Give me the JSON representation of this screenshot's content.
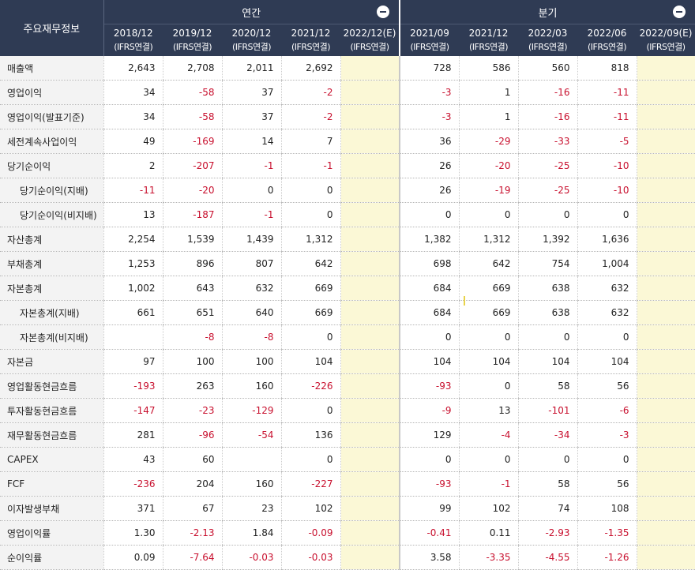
{
  "header": {
    "corner_label": "주요재무정보",
    "annual_label": "연간",
    "quarter_label": "분기",
    "periods": [
      {
        "period": "2018/12",
        "standard": "(IFRS연결)"
      },
      {
        "period": "2019/12",
        "standard": "(IFRS연결)"
      },
      {
        "period": "2020/12",
        "standard": "(IFRS연결)"
      },
      {
        "period": "2021/12",
        "standard": "(IFRS연결)"
      },
      {
        "period": "2022/12(E)",
        "standard": "(IFRS연결)"
      },
      {
        "period": "2021/09",
        "standard": "(IFRS연결)"
      },
      {
        "period": "2021/12",
        "standard": "(IFRS연결)"
      },
      {
        "period": "2022/03",
        "standard": "(IFRS연결)"
      },
      {
        "period": "2022/06",
        "standard": "(IFRS연결)"
      },
      {
        "period": "2022/09(E)",
        "standard": "(IFRS연결)"
      }
    ]
  },
  "colors": {
    "header_bg": "#2f3b54",
    "negative": "#c8102e",
    "estimate_bg": "#fbf8d6",
    "label_bg": "#f3f3f3"
  },
  "rows": [
    {
      "label": "매출액",
      "values": [
        "2,643",
        "2,708",
        "2,011",
        "2,692",
        "",
        "728",
        "586",
        "560",
        "818",
        ""
      ]
    },
    {
      "label": "영업이익",
      "values": [
        "34",
        "-58",
        "37",
        "-2",
        "",
        "-3",
        "1",
        "-16",
        "-11",
        ""
      ]
    },
    {
      "label": "영업이익(발표기준)",
      "values": [
        "34",
        "-58",
        "37",
        "-2",
        "",
        "-3",
        "1",
        "-16",
        "-11",
        ""
      ]
    },
    {
      "label": "세전계속사업이익",
      "values": [
        "49",
        "-169",
        "14",
        "7",
        "",
        "36",
        "-29",
        "-33",
        "-5",
        ""
      ]
    },
    {
      "label": "당기순이익",
      "values": [
        "2",
        "-207",
        "-1",
        "-1",
        "",
        "26",
        "-20",
        "-25",
        "-10",
        ""
      ]
    },
    {
      "label": "당기순이익(지배)",
      "values": [
        "-11",
        "-20",
        "0",
        "0",
        "",
        "26",
        "-19",
        "-25",
        "-10",
        ""
      ]
    },
    {
      "label": "당기순이익(비지배)",
      "values": [
        "13",
        "-187",
        "-1",
        "0",
        "",
        "0",
        "0",
        "0",
        "0",
        ""
      ]
    },
    {
      "label": "자산총계",
      "values": [
        "2,254",
        "1,539",
        "1,439",
        "1,312",
        "",
        "1,382",
        "1,312",
        "1,392",
        "1,636",
        ""
      ]
    },
    {
      "label": "부채총계",
      "values": [
        "1,253",
        "896",
        "807",
        "642",
        "",
        "698",
        "642",
        "754",
        "1,004",
        ""
      ]
    },
    {
      "label": "자본총계",
      "values": [
        "1,002",
        "643",
        "632",
        "669",
        "",
        "684",
        "669",
        "638",
        "632",
        ""
      ]
    },
    {
      "label": "자본총계(지배)",
      "values": [
        "661",
        "651",
        "640",
        "669",
        "",
        "684",
        "669",
        "638",
        "632",
        ""
      ]
    },
    {
      "label": "자본총계(비지배)",
      "values": [
        "",
        "-8",
        "-8",
        "0",
        "",
        "0",
        "0",
        "0",
        "0",
        ""
      ]
    },
    {
      "label": "자본금",
      "values": [
        "97",
        "100",
        "100",
        "104",
        "",
        "104",
        "104",
        "104",
        "104",
        ""
      ]
    },
    {
      "label": "영업활동현금흐름",
      "values": [
        "-193",
        "263",
        "160",
        "-226",
        "",
        "-93",
        "0",
        "58",
        "56",
        ""
      ]
    },
    {
      "label": "투자활동현금흐름",
      "values": [
        "-147",
        "-23",
        "-129",
        "0",
        "",
        "-9",
        "13",
        "-101",
        "-6",
        ""
      ]
    },
    {
      "label": "재무활동현금흐름",
      "values": [
        "281",
        "-96",
        "-54",
        "136",
        "",
        "129",
        "-4",
        "-34",
        "-3",
        ""
      ]
    },
    {
      "label": "CAPEX",
      "values": [
        "43",
        "60",
        "",
        "0",
        "",
        "0",
        "0",
        "0",
        "0",
        ""
      ]
    },
    {
      "label": "FCF",
      "values": [
        "-236",
        "204",
        "160",
        "-227",
        "",
        "-93",
        "-1",
        "58",
        "56",
        ""
      ]
    },
    {
      "label": "이자발생부채",
      "values": [
        "371",
        "67",
        "23",
        "102",
        "",
        "99",
        "102",
        "74",
        "108",
        ""
      ]
    },
    {
      "label": "영업이익률",
      "values": [
        "1.30",
        "-2.13",
        "1.84",
        "-0.09",
        "",
        "-0.41",
        "0.11",
        "-2.93",
        "-1.35",
        ""
      ]
    },
    {
      "label": "순이익률",
      "values": [
        "0.09",
        "-7.64",
        "-0.03",
        "-0.03",
        "",
        "3.58",
        "-3.35",
        "-4.55",
        "-1.26",
        ""
      ]
    }
  ]
}
